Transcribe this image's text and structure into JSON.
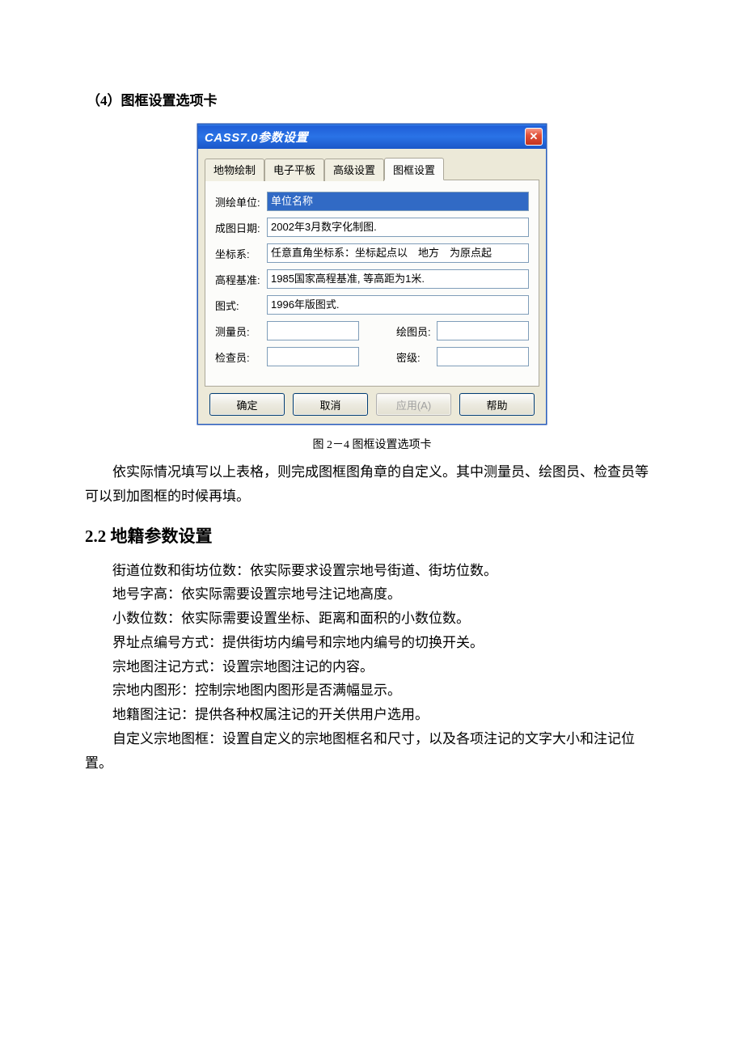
{
  "doc": {
    "section_label": "（4）图框设置选项卡",
    "dialog": {
      "title": "CASS7.0参数设置",
      "tabs": [
        "地物绘制",
        "电子平板",
        "高级设置",
        "图框设置"
      ],
      "active_tab_index": 3,
      "fields": {
        "unit_label": "测绘单位:",
        "unit_value": "单位名称",
        "date_label": "成图日期:",
        "date_value": "2002年3月数字化制图.",
        "coord_label": "坐标系:",
        "coord_value": "任意直角坐标系：坐标起点以　地方　为原点起",
        "datum_label": "高程基准:",
        "datum_value": "1985国家高程基准, 等高距为1米.",
        "style_label": "图式:",
        "style_value": "1996年版图式.",
        "surveyor_label": "测量员:",
        "surveyor_value": "",
        "drafter_label": "绘图员:",
        "drafter_value": "",
        "checker_label": "检查员:",
        "checker_value": "",
        "secret_label": "密级:",
        "secret_value": ""
      },
      "buttons": {
        "ok": "确定",
        "cancel": "取消",
        "apply": "应用(A)",
        "help": "帮助"
      }
    },
    "fig_caption": "图 2－4 图框设置选项卡",
    "para_after_fig": "依实际情况填写以上表格，则完成图框图角章的自定义。其中测量员、绘图员、检查员等可以到加图框的时候再填。",
    "h2": "2.2 地籍参数设置",
    "paras": [
      "街道位数和街坊位数：依实际要求设置宗地号街道、街坊位数。",
      "地号字高：依实际需要设置宗地号注记地高度。",
      "小数位数：依实际需要设置坐标、距离和面积的小数位数。",
      "界址点编号方式：提供街坊内编号和宗地内编号的切换开关。",
      "宗地图注记方式：设置宗地图注记的内容。",
      "宗地内图形：控制宗地图内图形是否满幅显示。",
      "地籍图注记：提供各种权属注记的开关供用户选用。",
      "自定义宗地图框：设置自定义的宗地图框名和尺寸，以及各项注记的文字大小和注记位置。"
    ]
  }
}
